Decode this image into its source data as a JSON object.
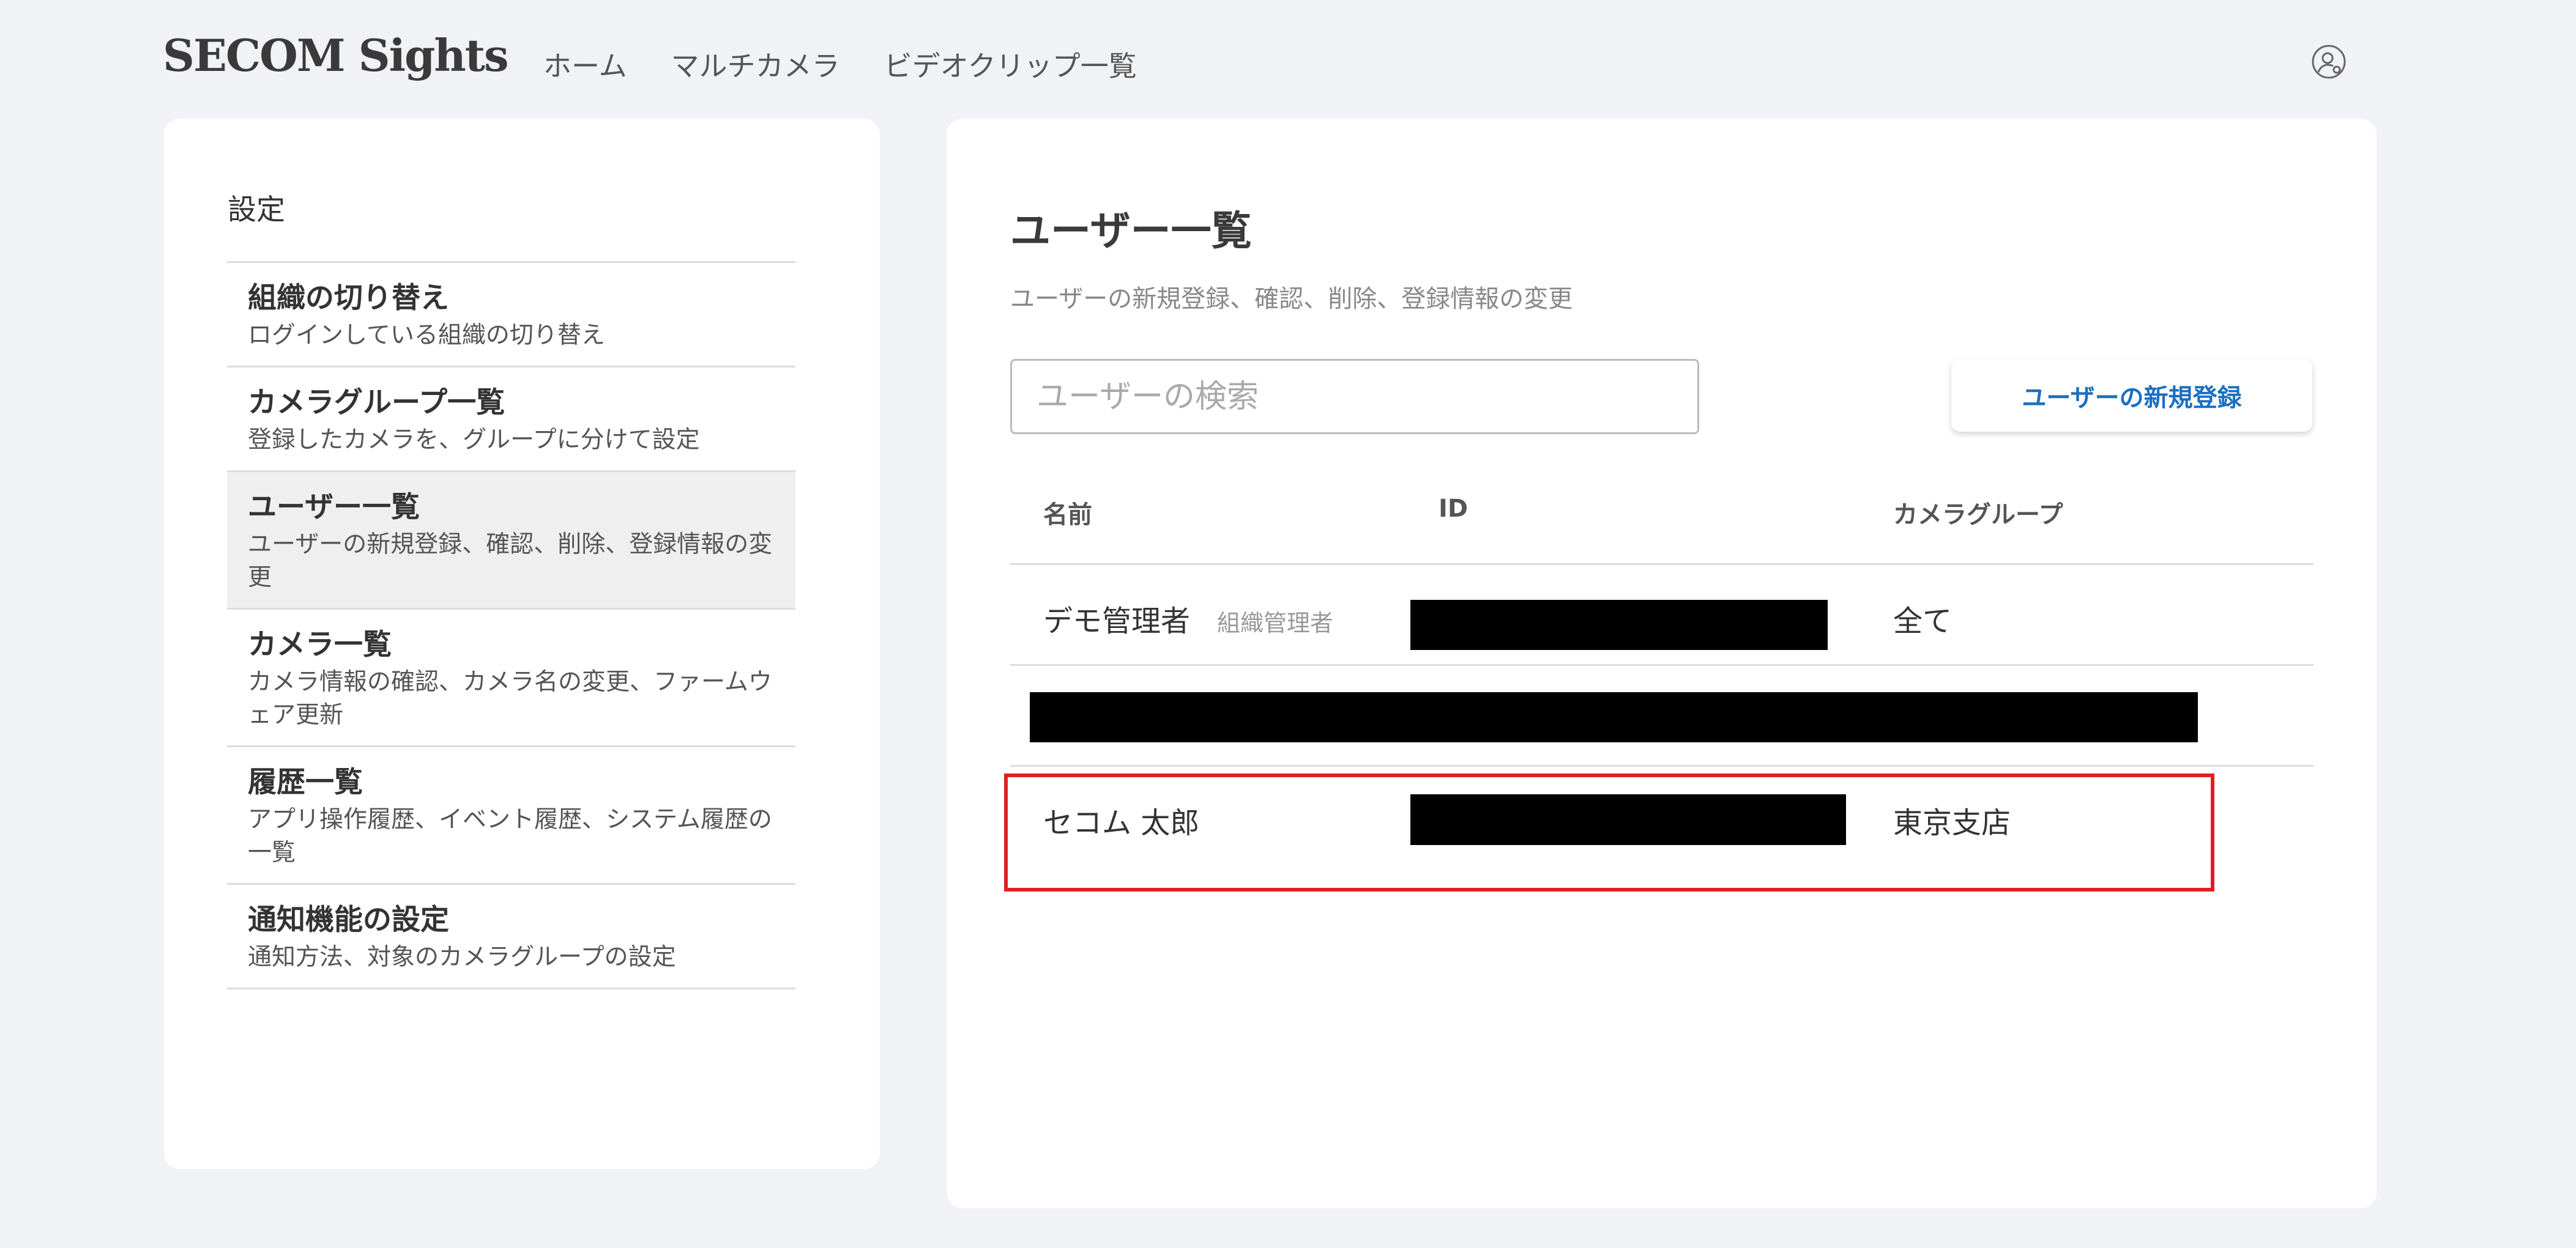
{
  "header": {
    "logo": "SECOM Sights",
    "nav": [
      "ホーム",
      "マルチカメラ",
      "ビデオクリップ一覧"
    ]
  },
  "sidebar": {
    "title": "設定",
    "items": [
      {
        "title": "組織の切り替え",
        "desc": "ログインしている組織の切り替え"
      },
      {
        "title": "カメラグループ一覧",
        "desc": "登録したカメラを、グループに分けて設定"
      },
      {
        "title": "ユーザー一覧",
        "desc": "ユーザーの新規登録、確認、削除、登録情報の変更"
      },
      {
        "title": "カメラ一覧",
        "desc": "カメラ情報の確認、カメラ名の変更、ファームウェア更新"
      },
      {
        "title": "履歴一覧",
        "desc": "アプリ操作履歴、イベント履歴、システム履歴の一覧"
      },
      {
        "title": "通知機能の設定",
        "desc": "通知方法、対象のカメラグループの設定"
      }
    ]
  },
  "main": {
    "title": "ユーザー一覧",
    "subtitle": "ユーザーの新規登録、確認、削除、登録情報の変更",
    "search": {
      "placeholder": "ユーザーの検索",
      "value": ""
    },
    "new_user_button": "ユーザーの新規登録",
    "table": {
      "columns": [
        "名前",
        "ID",
        "カメラグループ"
      ],
      "rows": [
        {
          "name": "デモ管理者",
          "role": "組織管理者",
          "id": "",
          "group": "全て"
        },
        {
          "name": "",
          "role": "",
          "id": "",
          "group": ""
        },
        {
          "name": "セコム 太郎",
          "role": "",
          "id": "",
          "group": "東京支店"
        }
      ]
    }
  },
  "colors": {
    "accent": "#1a6fc2",
    "highlight": "#e02020",
    "background": "#f1f2f5",
    "panel": "#ffffff"
  },
  "icons": {
    "account": "user-settings-icon"
  }
}
